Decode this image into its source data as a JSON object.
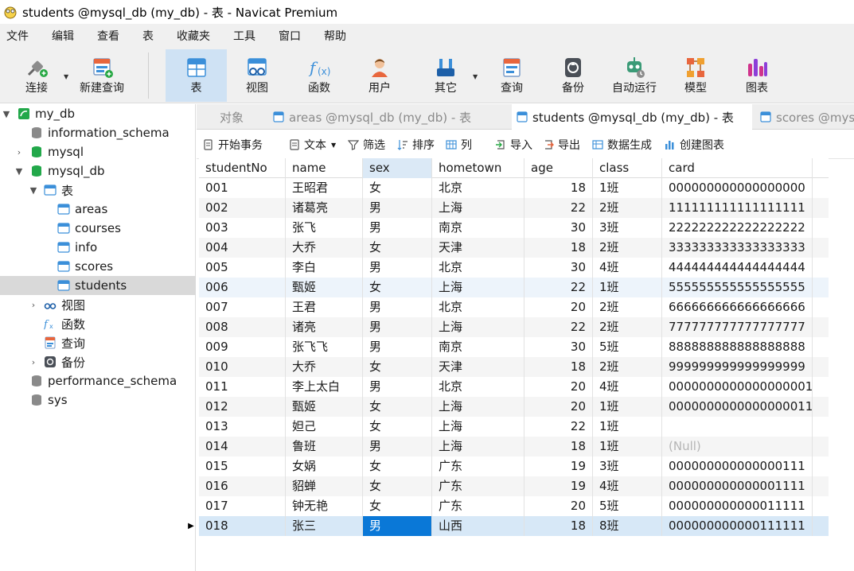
{
  "window": {
    "title": "students @mysql_db (my_db) - 表 - Navicat Premium"
  },
  "menu": [
    "文件",
    "编辑",
    "查看",
    "表",
    "收藏夹",
    "工具",
    "窗口",
    "帮助"
  ],
  "toolbar": {
    "connect": "连接",
    "new_query": "新建查询",
    "table": "表",
    "view": "视图",
    "function": "函数",
    "user": "用户",
    "other": "其它",
    "query": "查询",
    "backup": "备份",
    "automation": "自动运行",
    "model": "模型",
    "chart": "图表"
  },
  "sidebar": {
    "connection": "my_db",
    "databases": [
      "information_schema",
      "mysql",
      "mysql_db",
      "performance_schema",
      "sys"
    ],
    "tables_folder": "表",
    "tables": [
      "areas",
      "courses",
      "info",
      "scores",
      "students"
    ],
    "views": "视图",
    "functions": "函数",
    "queries": "查询",
    "backups": "备份"
  },
  "tabs": {
    "objects": "对象",
    "areas": "areas @mysql_db (my_db) - 表",
    "students": "students @mysql_db (my_db) - 表",
    "scores": "scores @mysql_db (my_db) - 表"
  },
  "actions": {
    "begin_transaction": "开始事务",
    "text": "文本",
    "filter": "筛选",
    "sort": "排序",
    "columns": "列",
    "import": "导入",
    "export": "导出",
    "data_generation": "数据生成",
    "create_chart": "创建图表"
  },
  "grid": {
    "columns": [
      "studentNo",
      "name",
      "sex",
      "hometown",
      "age",
      "class",
      "card"
    ],
    "rows": [
      [
        "001",
        "王昭君",
        "女",
        "北京",
        "18",
        "1班",
        "000000000000000000"
      ],
      [
        "002",
        "诸葛亮",
        "男",
        "上海",
        "22",
        "2班",
        "111111111111111111"
      ],
      [
        "003",
        "张飞",
        "男",
        "南京",
        "30",
        "3班",
        "222222222222222222"
      ],
      [
        "004",
        "大乔",
        "女",
        "天津",
        "18",
        "2班",
        "333333333333333333"
      ],
      [
        "005",
        "李白",
        "男",
        "北京",
        "30",
        "4班",
        "444444444444444444"
      ],
      [
        "006",
        "甄姬",
        "女",
        "上海",
        "22",
        "1班",
        "555555555555555555"
      ],
      [
        "007",
        "王君",
        "男",
        "北京",
        "20",
        "2班",
        "666666666666666666"
      ],
      [
        "008",
        "诸亮",
        "男",
        "上海",
        "22",
        "2班",
        "777777777777777777"
      ],
      [
        "009",
        "张飞飞",
        "男",
        "南京",
        "30",
        "5班",
        "888888888888888888"
      ],
      [
        "010",
        "大乔",
        "女",
        "天津",
        "18",
        "2班",
        "999999999999999999"
      ],
      [
        "011",
        "李上太白",
        "男",
        "北京",
        "20",
        "4班",
        "0000000000000000001"
      ],
      [
        "012",
        "甄姬",
        "女",
        "上海",
        "20",
        "1班",
        "0000000000000000011"
      ],
      [
        "013",
        "妲己",
        "女",
        "上海",
        "22",
        "1班",
        ""
      ],
      [
        "014",
        "鲁班",
        "男",
        "上海",
        "18",
        "1班",
        "(Null)"
      ],
      [
        "015",
        "女娲",
        "女",
        "广东",
        "19",
        "3班",
        "000000000000000111"
      ],
      [
        "016",
        "貂蝉",
        "女",
        "广东",
        "19",
        "4班",
        "000000000000001111"
      ],
      [
        "017",
        "钟无艳",
        "女",
        "广东",
        "20",
        "5班",
        "000000000000011111"
      ],
      [
        "018",
        "张三",
        "男",
        "山西",
        "18",
        "8班",
        "000000000000111111"
      ]
    ]
  },
  "colors": {
    "accent": "#0a78d7",
    "toolbar_active": "#cfe2f4",
    "db_green": "#22a84a",
    "table_blue": "#3b8fd9",
    "null_gray": "#b5b5b5"
  }
}
